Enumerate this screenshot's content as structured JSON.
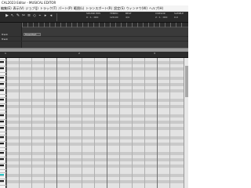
{
  "title": "CAL2023 Editor - MUSICAL EDITOR",
  "menu": [
    "編集(E)",
    "表示(V)",
    "ジョブ(J)",
    "トラック(T)",
    "パート(P)",
    "範囲(L)",
    "トランスポート(R)",
    "設定(S)",
    "ウィンドウ(W)",
    "ヘルプ(H)"
  ],
  "toolbar": {
    "tools": [
      "▶",
      "↖",
      "✎",
      "✂",
      "≡",
      "◇",
      "⌁",
      "▸",
      "◂"
    ],
    "fields": [
      {
        "label": "SOUND POS",
        "value": "0 : 1 : 000"
      },
      {
        "label": "TEMPO",
        "value": "120.00"
      },
      {
        "label": "BEAT",
        "value": "4/4"
      },
      {
        "label": "CURSOR",
        "value": "2 : 1 : 000"
      },
      {
        "label": "SAMPLE",
        "value": "0.0"
      }
    ]
  },
  "tracks": [
    {
      "name": "Track",
      "clip": "MusicPart"
    },
    {
      "name": "Track",
      "clip": ""
    }
  ],
  "editor": {
    "bars": [
      "1",
      "2",
      "3"
    ],
    "active_key_row": 37
  },
  "colors": {
    "accent": "#29c7c7",
    "toolbar_bg": "#2a2a2a",
    "grid_light": "#e3e3e3",
    "grid_dark": "#c9c9c9"
  }
}
